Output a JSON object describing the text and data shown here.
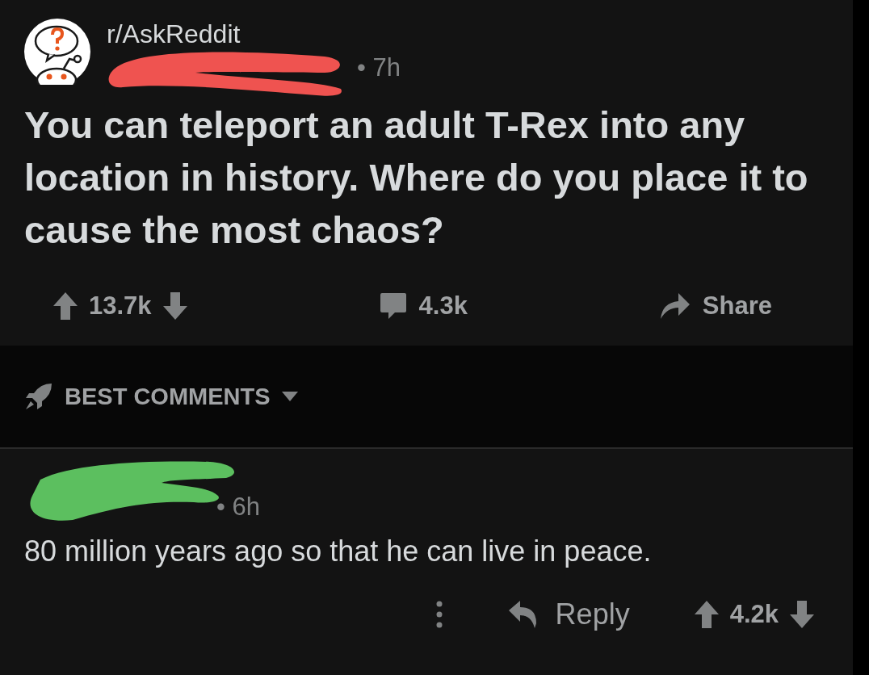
{
  "post": {
    "subreddit": "r/AskReddit",
    "meta": "• 7h",
    "title": "You can teleport an adult T-Rex into any location in history. Where do you place it to cause the most chaos?",
    "score": "13.7k",
    "comments": "4.3k",
    "share": "Share"
  },
  "sort": {
    "label": "BEST COMMENTS"
  },
  "comment": {
    "meta": "• 6h",
    "body": "80 million years ago so that he can live in peace.",
    "reply": "Reply",
    "score": "4.2k"
  }
}
